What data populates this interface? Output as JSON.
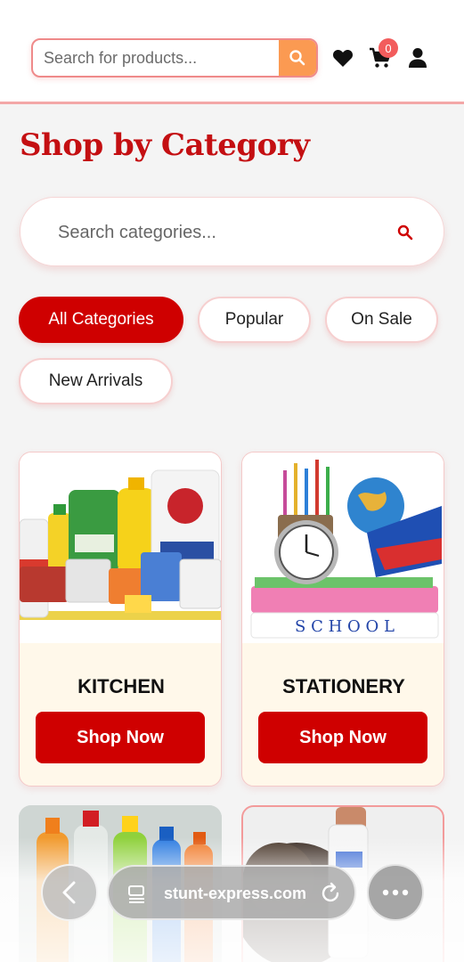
{
  "header": {
    "search_placeholder": "Search for products...",
    "cart_count": "0",
    "icons": [
      "search-icon",
      "heart-icon",
      "cart-icon",
      "user-icon"
    ]
  },
  "page_title": "Shop by Category",
  "category_search": {
    "placeholder": "Search categories..."
  },
  "filters": [
    {
      "label": "All Categories",
      "active": true
    },
    {
      "label": "Popular",
      "active": false
    },
    {
      "label": "On Sale",
      "active": false
    },
    {
      "label": "New Arrivals",
      "active": false
    }
  ],
  "categories": [
    {
      "name": "KITCHEN",
      "button": "Shop Now"
    },
    {
      "name": "STATIONERY",
      "button": "Shop Now"
    }
  ],
  "browser": {
    "url": "stunt-express.com"
  },
  "colors": {
    "brand_red": "#cf0000",
    "title_red": "#c40f12",
    "accent_orange": "#fb9a52",
    "badge": "#f25c5c"
  }
}
